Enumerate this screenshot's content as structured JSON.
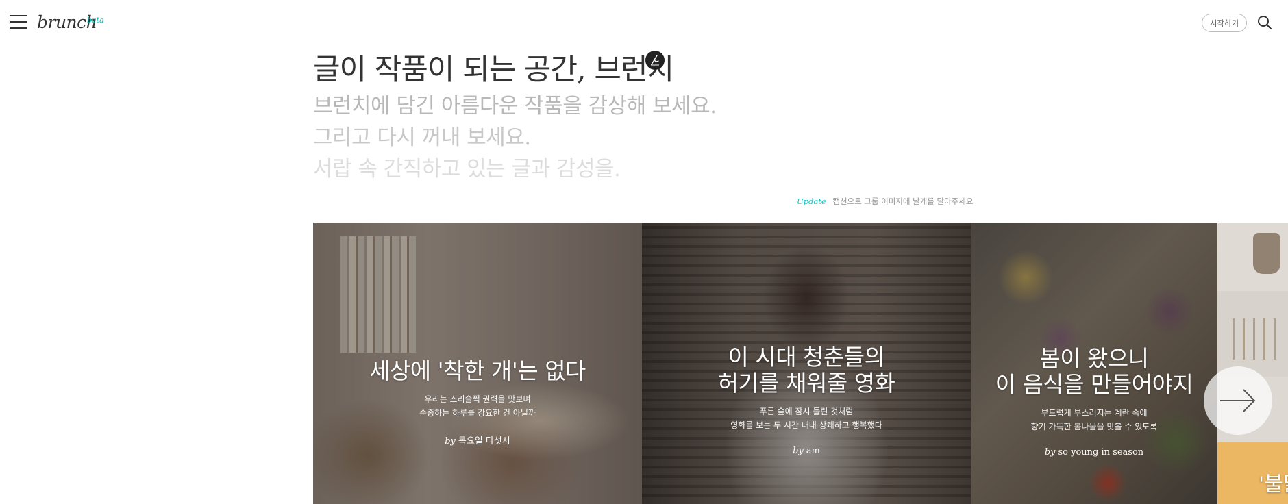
{
  "header": {
    "logo": "brunch",
    "beta": "beta",
    "start_label": "시작하기"
  },
  "intro": {
    "title": "글이 작품이 되는 공간, 브런치",
    "lines": [
      "브런치에 담긴 아름다운 작품을 감상해 보세요.",
      "그리고 다시 꺼내 보세요.",
      "서랍 속 간직하고 있는 글과 감성을."
    ]
  },
  "update": {
    "tag": "Update",
    "text": "캡션으로 그룹 이미지에 날개를 달아주세요"
  },
  "cards": [
    {
      "title": "세상에 '착한 개'는 없다",
      "desc": "우리는 스리슬쩍 권력을 맛보며\n순종하는 하루를 강요한 건 아닐까",
      "by": "by",
      "author": "목요일 다섯시"
    },
    {
      "title": "이 시대 청춘들의\n허기를 채워줄 영화",
      "desc": "푸른 숲에 잠시 들린 것처럼\n영화를 보는 두 시간 내내 상쾌하고 행복했다",
      "by": "by",
      "author": "am"
    },
    {
      "title": "봄이 왔으니\n이 음식을 만들어야지",
      "desc": "부드럽게 부스러지는 계란 속에\n향기 가득한 봄나물을 맛볼 수 있도록",
      "by": "by",
      "author": "so young in season"
    },
    {
      "title": "'불닭'"
    }
  ],
  "icons": {
    "menu": "hamburger-icon",
    "search": "search-icon",
    "next": "arrow-right-icon",
    "pen": "pen-icon"
  },
  "colors": {
    "accent": "#00c6be",
    "text": "#333333"
  }
}
